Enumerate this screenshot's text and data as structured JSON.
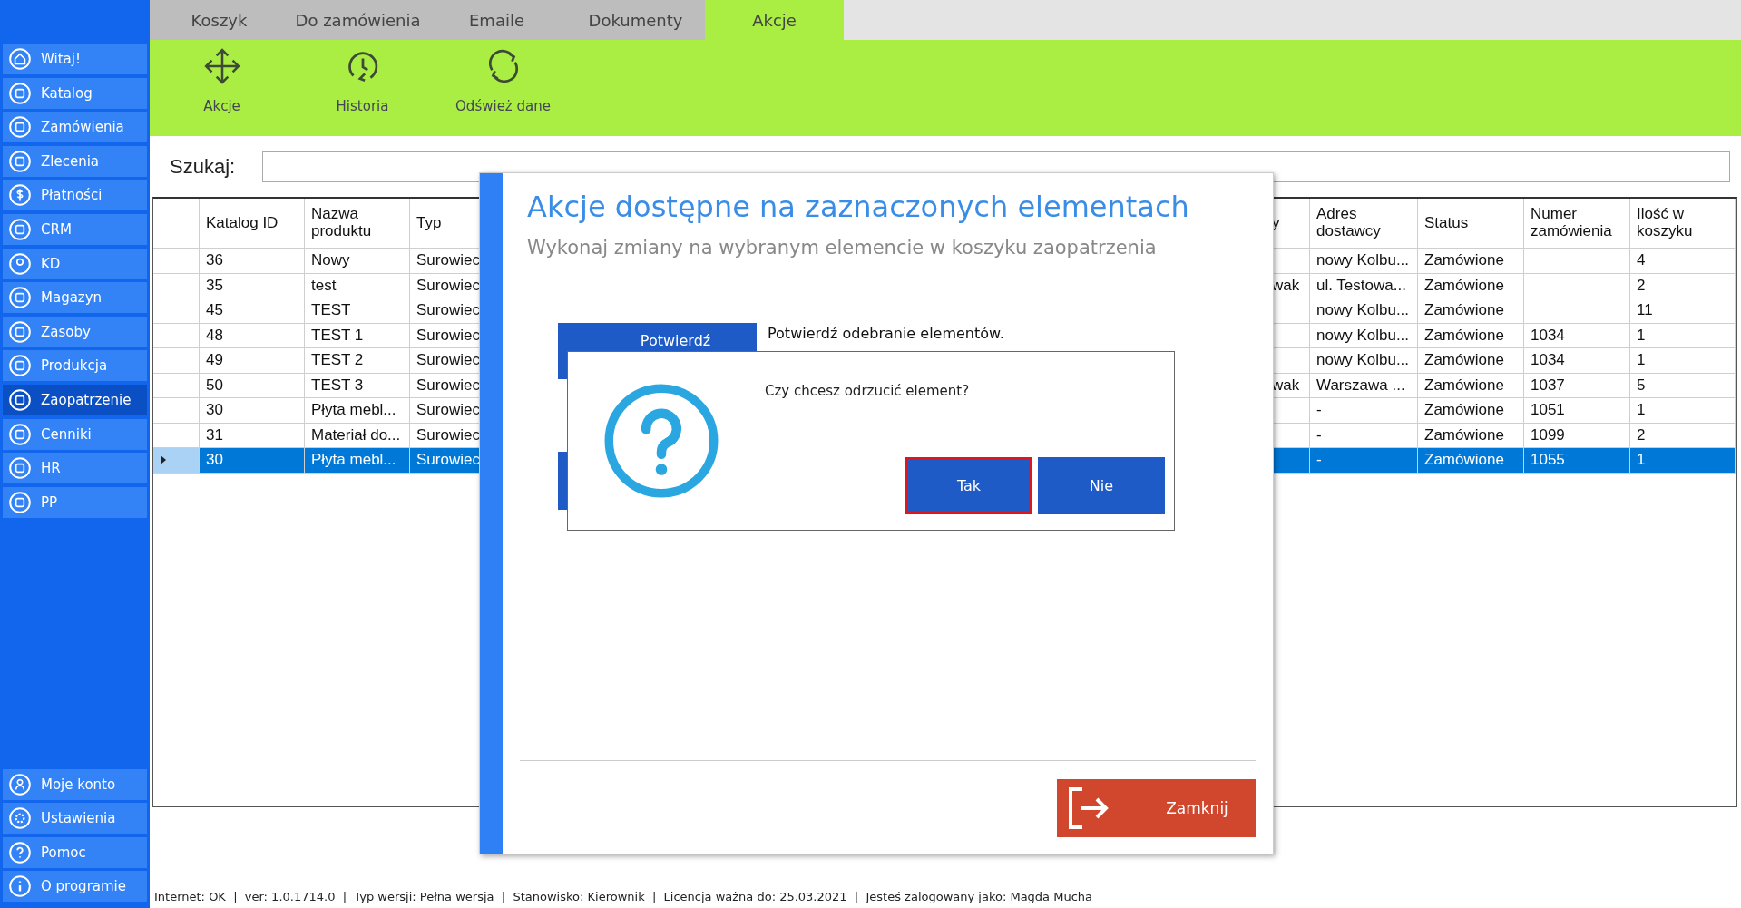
{
  "sidebar": {
    "items": [
      {
        "label": "Witaj!",
        "selected": false
      },
      {
        "label": "Katalog",
        "selected": false
      },
      {
        "label": "Zamówienia",
        "selected": false
      },
      {
        "label": "Zlecenia",
        "selected": false
      },
      {
        "label": "Płatności",
        "selected": false
      },
      {
        "label": "CRM",
        "selected": false
      },
      {
        "label": "KD",
        "selected": false
      },
      {
        "label": "Magazyn",
        "selected": false
      },
      {
        "label": "Zasoby",
        "selected": false
      },
      {
        "label": "Produkcja",
        "selected": false
      },
      {
        "label": "Zaopatrzenie",
        "selected": true
      },
      {
        "label": "Cenniki",
        "selected": false
      },
      {
        "label": "HR",
        "selected": false
      },
      {
        "label": "PP",
        "selected": false
      }
    ],
    "bottom_items": [
      {
        "label": "Moje konto"
      },
      {
        "label": "Ustawienia"
      },
      {
        "label": "Pomoc"
      },
      {
        "label": "O programie"
      }
    ]
  },
  "tabs": [
    {
      "label": "Koszyk",
      "selected": false
    },
    {
      "label": "Do zamówienia",
      "selected": false
    },
    {
      "label": "Emaile",
      "selected": false
    },
    {
      "label": "Dokumenty",
      "selected": false
    },
    {
      "label": "Akcje",
      "selected": true
    }
  ],
  "toolbar": [
    {
      "label": "Akcje"
    },
    {
      "label": "Historia"
    },
    {
      "label": "Odśwież dane"
    }
  ],
  "search": {
    "label": "Szukaj:"
  },
  "table": {
    "columns": [
      "Katalog ID",
      "Nazwa produktu",
      "Typ",
      "y",
      "Adres dostawcy",
      "Status",
      "Numer zamówienia",
      "Ilość w koszyku"
    ],
    "rows": [
      {
        "cells": [
          "36",
          "Nowy",
          "Surowiec",
          null,
          "nowy Kolbu...",
          "Zamówione",
          null,
          "4"
        ],
        "selected": false
      },
      {
        "cells": [
          "35",
          "test",
          "Surowiec",
          "wak",
          "ul. Testowa...",
          "Zamówione",
          null,
          "2"
        ],
        "selected": false
      },
      {
        "cells": [
          "45",
          "TEST",
          "Surowiec",
          null,
          "nowy Kolbu...",
          "Zamówione",
          null,
          "11"
        ],
        "selected": false
      },
      {
        "cells": [
          "48",
          "TEST 1",
          "Surowiec",
          null,
          "nowy Kolbu...",
          "Zamówione",
          "1034",
          "1"
        ],
        "selected": false
      },
      {
        "cells": [
          "49",
          "TEST 2",
          "Surowiec",
          null,
          "nowy Kolbu...",
          "Zamówione",
          "1034",
          "1"
        ],
        "selected": false
      },
      {
        "cells": [
          "50",
          "TEST 3",
          "Surowiec",
          "wak",
          "Warszawa ...",
          "Zamówione",
          "1037",
          "5"
        ],
        "selected": false
      },
      {
        "cells": [
          "30",
          "Płyta mebl...",
          "Surowiec",
          null,
          "-",
          "Zamówione",
          "1051",
          "1"
        ],
        "selected": false
      },
      {
        "cells": [
          "31",
          "Materiał do...",
          "Surowiec",
          null,
          "-",
          "Zamówione",
          "1099",
          "2"
        ],
        "selected": false
      },
      {
        "cells": [
          "30",
          "Płyta mebl...",
          "Surowiec",
          null,
          "-",
          "Zamówione",
          "1055",
          "1"
        ],
        "selected": true
      }
    ]
  },
  "dialog": {
    "title": "Akcje dostępne na zaznaczonych elementach",
    "subtitle": "Wykonaj zmiany na wybranym elemencie w koszyku zaopatrzenia",
    "actions": [
      {
        "label": "Potwierdź",
        "description": "Potwierdź odebranie elementów."
      }
    ],
    "close_button": "Zamknij"
  },
  "message_box": {
    "text": "Czy chcesz odrzucić element?",
    "buttons": [
      {
        "label": "Tak",
        "focused": true
      },
      {
        "label": "Nie",
        "focused": false
      }
    ]
  },
  "status_bar": "Internet: OK  |  ver: 1.0.1714.0  |  Typ wersji: Pełna wersja  |  Stanowisko: Kierownik  |  Licencja ważna do: 25.03.2021  |  Jesteś zalogowany jako: Magda Mucha"
}
